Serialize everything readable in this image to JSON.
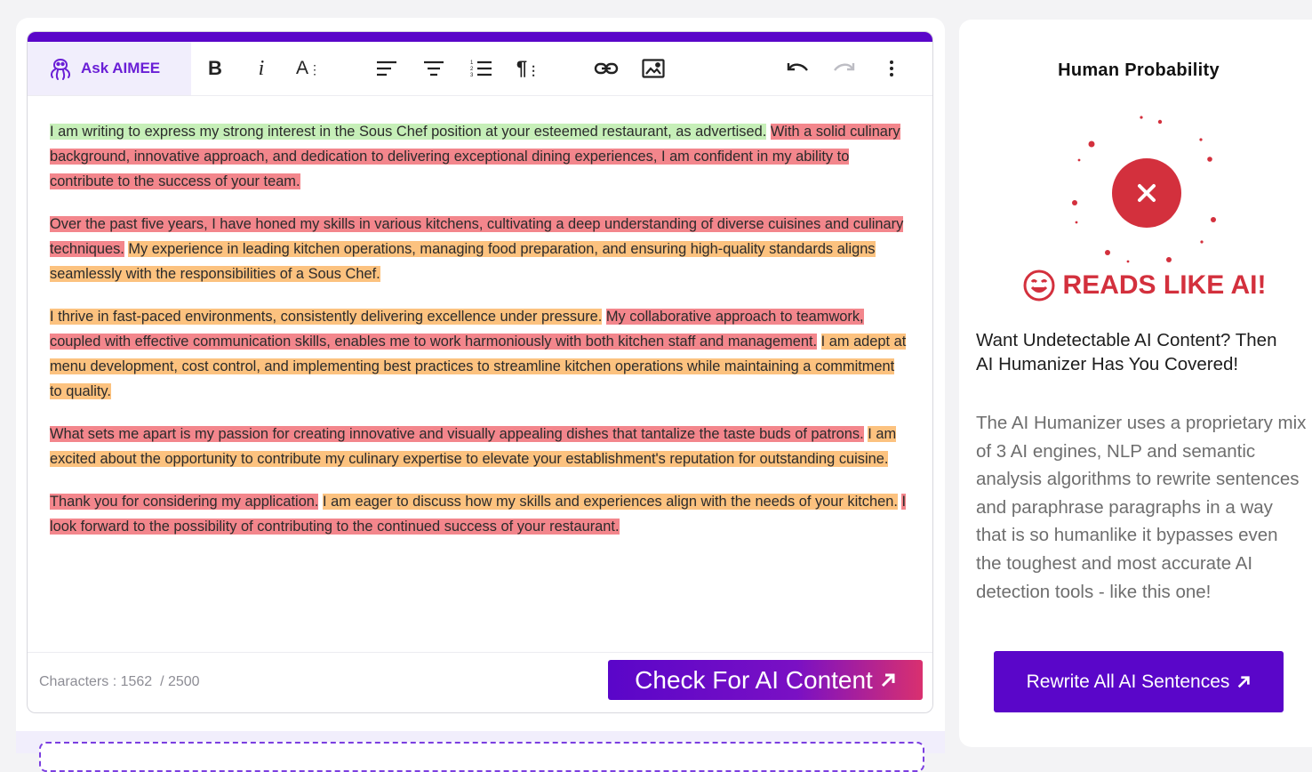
{
  "editor": {
    "ask_label": "Ask AIMEE",
    "toolbar_icons": [
      "bold-icon",
      "italic-icon",
      "font-size-icon",
      "align-left-icon",
      "align-center-icon",
      "ordered-list-icon",
      "paragraph-format-icon",
      "link-icon",
      "image-icon",
      "undo-icon",
      "redo-icon",
      "more-vertical-icon"
    ],
    "paragraphs": [
      [
        {
          "text": "I am writing to express my strong interest in the Sous Chef position at your esteemed restaurant, as advertised.",
          "hl": "green"
        },
        {
          "text": " ",
          "hl": ""
        },
        {
          "text": "With a solid culinary background, innovative approach, and dedication to delivering exceptional dining experiences, I am confident in my ability to contribute to the success of your team.",
          "hl": "red"
        }
      ],
      [
        {
          "text": "Over the past five years, I have honed my skills in various kitchens, cultivating a deep understanding of diverse cuisines and culinary techniques.",
          "hl": "red"
        },
        {
          "text": " ",
          "hl": ""
        },
        {
          "text": "My experience in leading kitchen operations, managing food preparation, and ensuring high-quality standards aligns seamlessly with the responsibilities of a Sous Chef.",
          "hl": "orange"
        }
      ],
      [
        {
          "text": "I thrive in fast-paced environments, consistently delivering excellence under pressure.",
          "hl": "orange"
        },
        {
          "text": " ",
          "hl": ""
        },
        {
          "text": "My collaborative approach to teamwork, coupled with effective communication skills, enables me to work harmoniously with both kitchen staff and management.",
          "hl": "red"
        },
        {
          "text": " ",
          "hl": ""
        },
        {
          "text": "I am adept at menu development, cost control, and implementing best practices to streamline kitchen operations while maintaining a commitment to quality.",
          "hl": "orange"
        }
      ],
      [
        {
          "text": "What sets me apart is my passion for creating innovative and visually appealing dishes that tantalize the taste buds of patrons.",
          "hl": "red"
        },
        {
          "text": " ",
          "hl": ""
        },
        {
          "text": "I am excited about the opportunity to contribute my culinary expertise to elevate your establishment's reputation for outstanding cuisine.",
          "hl": "orange"
        }
      ],
      [
        {
          "text": "Thank you for considering my application.",
          "hl": "red"
        },
        {
          "text": " ",
          "hl": ""
        },
        {
          "text": "I am eager to discuss how my skills and experiences align with the needs of your kitchen.",
          "hl": "orange"
        },
        {
          "text": " ",
          "hl": ""
        },
        {
          "text": "I look forward to the possibility of contributing to the continued success of your restaurant.",
          "hl": "red"
        }
      ]
    ],
    "footer": {
      "char_label": "Characters : ",
      "char_count": "1562",
      "char_limit": "  / 2500",
      "check_label": "Check For AI Content"
    }
  },
  "result": {
    "title": "Human Probability",
    "verdict": "READS LIKE AI!",
    "verdict_color": "#d3303d",
    "promo_title": "Want Undetectable AI Content? Then AI Humanizer Has You Covered!",
    "promo_body": "The AI Humanizer uses a proprietary mix of 3 AI engines, NLP and semantic analysis algorithms to rewrite sentences and paraphrase paragraphs in a way that is so humanlike it bypasses even the toughest and most accurate AI detection tools - like this one!",
    "rewrite_label": "Rewrite All AI Sentences"
  },
  "colors": {
    "brand": "#5a06c9",
    "green_highlight": "#c6efb8",
    "red_highlight": "#f3868c",
    "orange_highlight": "#fcc27f"
  }
}
